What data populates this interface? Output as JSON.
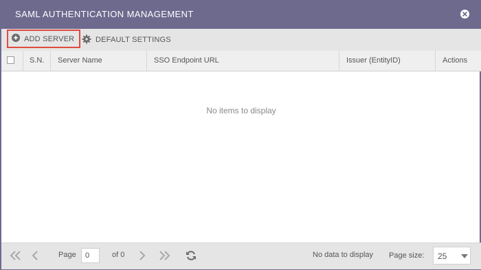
{
  "dialog": {
    "title": "SAML AUTHENTICATION MANAGEMENT"
  },
  "toolbar": {
    "add_server_label": "ADD SERVER",
    "default_settings_label": "DEFAULT SETTINGS",
    "add_icon": "plus-circle-icon",
    "settings_icon": "gear-icon"
  },
  "grid": {
    "columns": [
      "S.N.",
      "Server Name",
      "SSO Endpoint URL",
      "Issuer (EntityID)",
      "Actions"
    ],
    "empty_message": "No items to display"
  },
  "pager": {
    "page_label": "Page",
    "page_value": "0",
    "of_label": "of 0",
    "status_text": "No data to display",
    "page_size_label": "Page size:",
    "page_size_value": "25"
  },
  "colors": {
    "titlebar": "#6e6a8e",
    "highlight": "#e04a3f"
  }
}
